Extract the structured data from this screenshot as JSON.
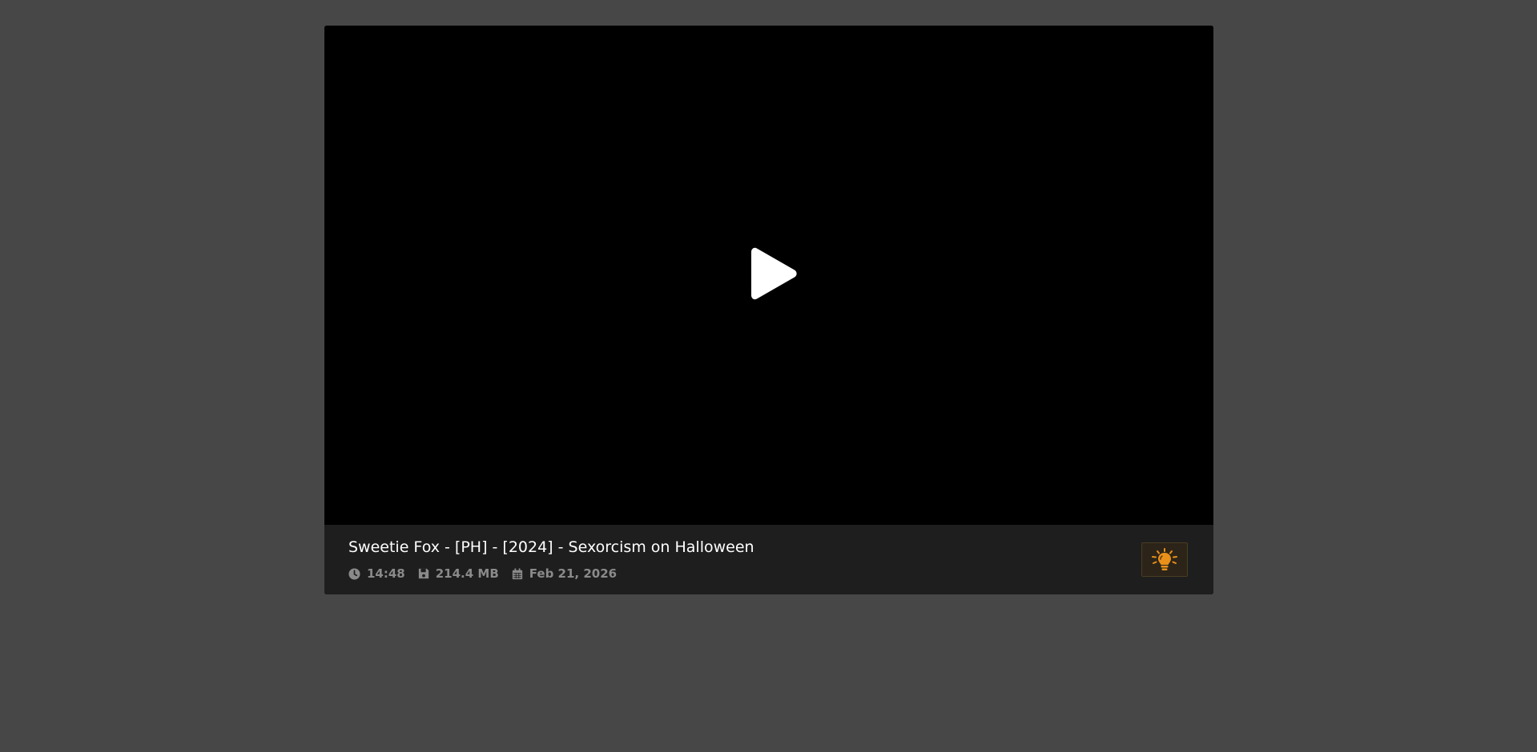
{
  "video": {
    "title": "Sweetie Fox - [PH] - [2024] - Sexorcism on Halloween",
    "duration": "14:48",
    "file_size": "214.4 MB",
    "date": "Feb 21, 2026"
  },
  "icons": {
    "play": "play-icon",
    "duration": "clock-icon",
    "file_size": "floppy-disk-icon",
    "date": "calendar-icon",
    "lamp": "lightbulb-icon"
  },
  "colors": {
    "page_background": "#464746",
    "video_background": "#000000",
    "info_background": "#1e1e1e",
    "title_text": "#ffffff",
    "meta_text": "#8a8a8a",
    "lamp_accent": "#e8901a"
  }
}
